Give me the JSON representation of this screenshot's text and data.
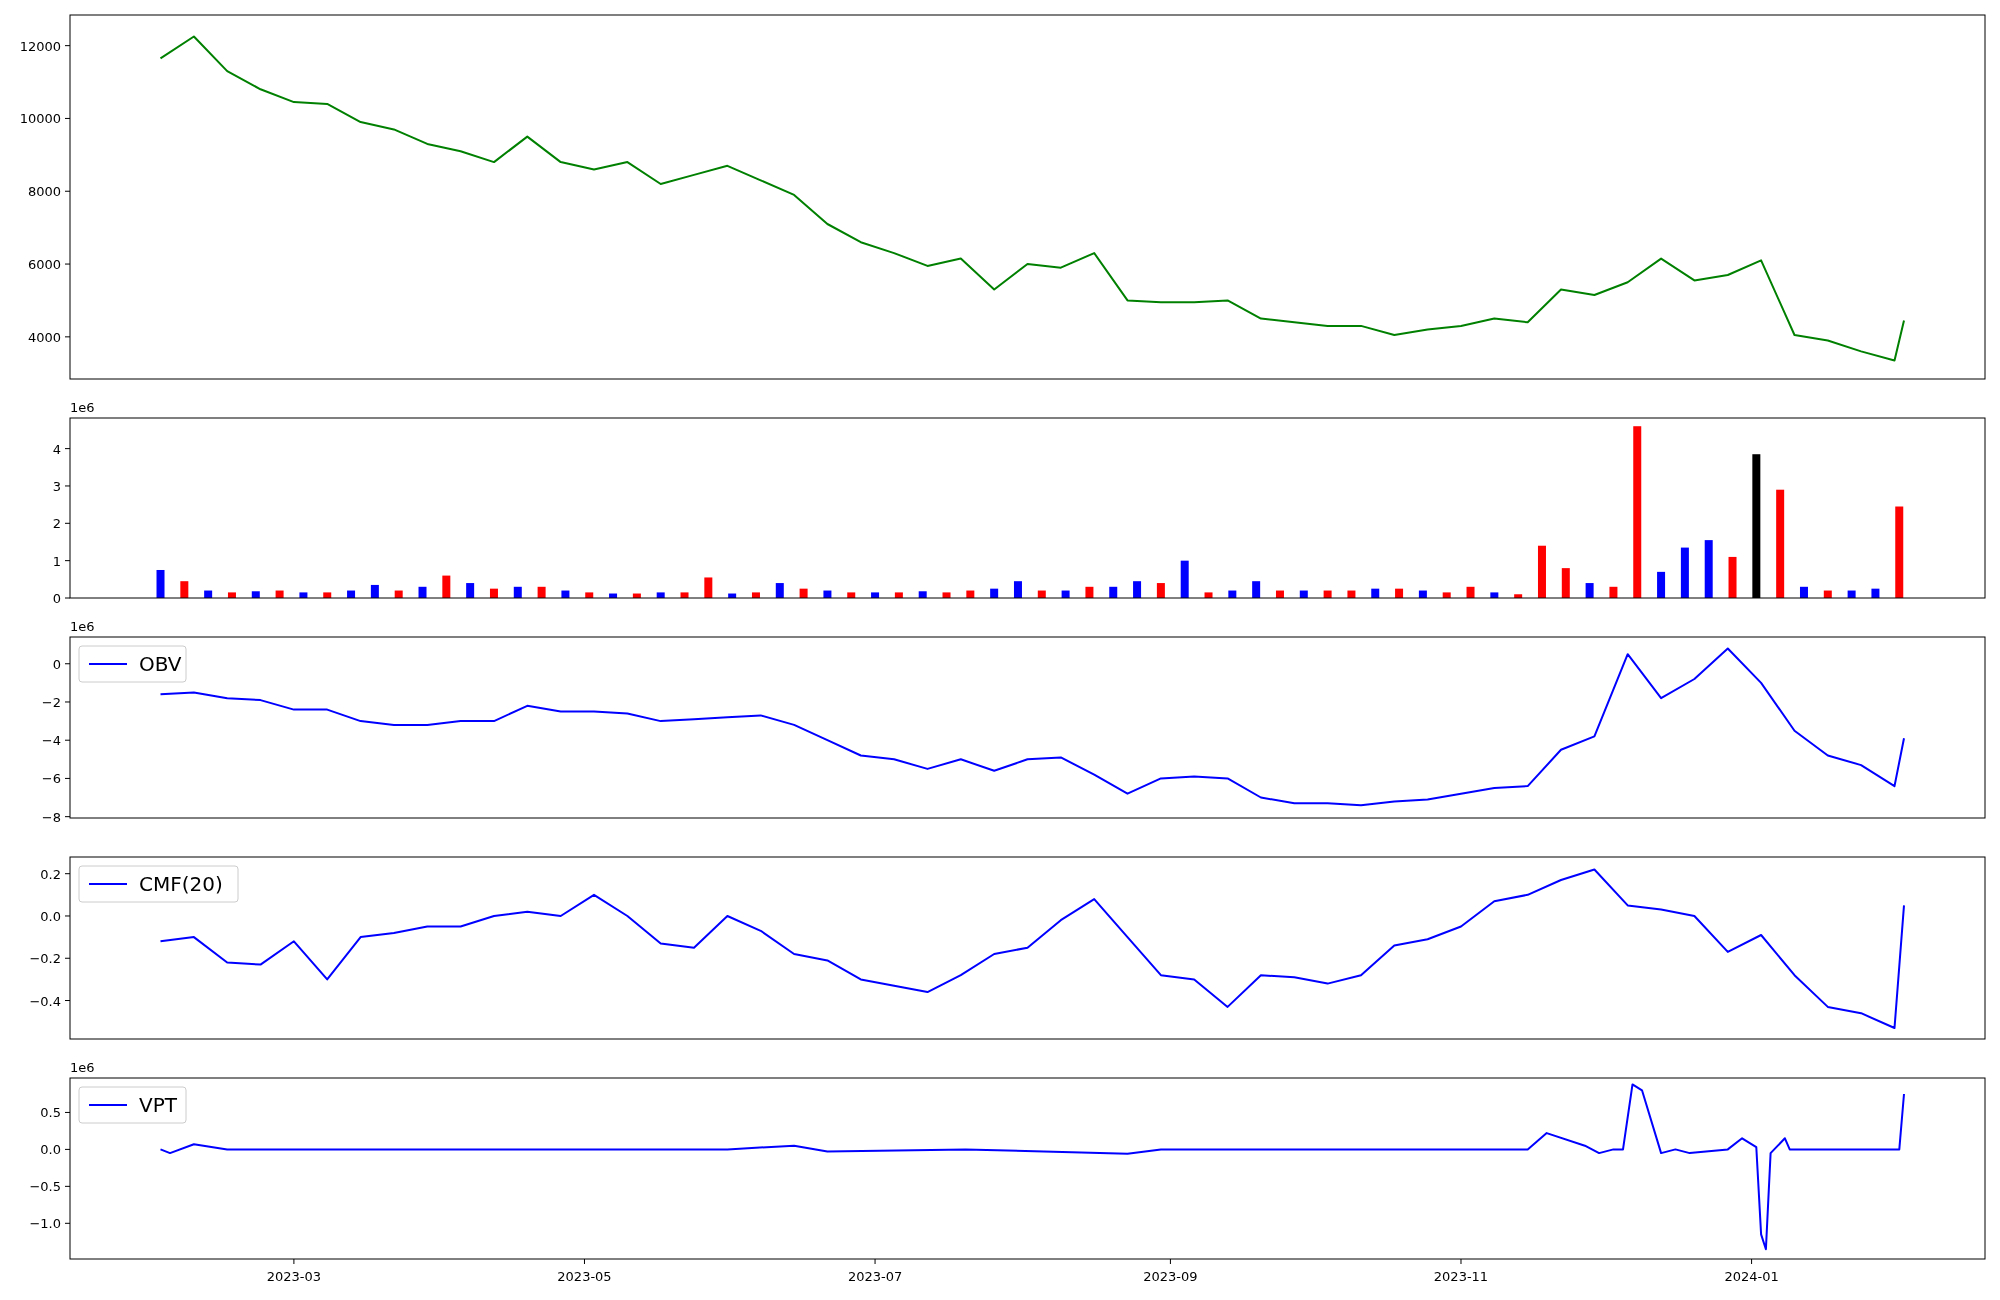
{
  "panels": [
    {
      "chart_data": {
        "type": "line",
        "x": [
          "2023-02-01",
          "2023-02-08",
          "2023-02-15",
          "2023-02-22",
          "2023-03-01",
          "2023-03-08",
          "2023-03-15",
          "2023-03-22",
          "2023-03-29",
          "2023-04-05",
          "2023-04-12",
          "2023-04-19",
          "2023-04-26",
          "2023-05-03",
          "2023-05-10",
          "2023-05-17",
          "2023-05-24",
          "2023-05-31",
          "2023-06-07",
          "2023-06-14",
          "2023-06-21",
          "2023-06-28",
          "2023-07-05",
          "2023-07-12",
          "2023-07-19",
          "2023-07-26",
          "2023-08-02",
          "2023-08-09",
          "2023-08-16",
          "2023-08-23",
          "2023-08-30",
          "2023-09-06",
          "2023-09-13",
          "2023-09-20",
          "2023-09-27",
          "2023-10-04",
          "2023-10-11",
          "2023-10-18",
          "2023-10-25",
          "2023-11-01",
          "2023-11-08",
          "2023-11-15",
          "2023-11-22",
          "2023-11-29",
          "2023-12-06",
          "2023-12-13",
          "2023-12-20",
          "2023-12-27",
          "2024-01-03",
          "2024-01-10",
          "2024-01-17",
          "2024-01-24",
          "2024-01-31",
          "2024-02-02"
        ],
        "series": [
          {
            "color": "#008000",
            "values": [
              11650,
              12250,
              11300,
              10800,
              10450,
              10400,
              9900,
              9700,
              9300,
              9100,
              8800,
              9500,
              8800,
              8600,
              8800,
              8200,
              8450,
              8700,
              8300,
              7900,
              7100,
              6600,
              6300,
              5950,
              6150,
              5300,
              6000,
              5900,
              6300,
              5000,
              4950,
              4950,
              5000,
              4500,
              4400,
              4300,
              4300,
              4050,
              4200,
              4300,
              4500,
              4400,
              5300,
              5150,
              5500,
              6150,
              5550,
              5700,
              6100,
              4050,
              3900,
              3600,
              3350,
              4450
            ]
          }
        ],
        "xlim": [
          "2023-01-13",
          "2024-02-19"
        ],
        "ylim": [
          2842,
          12842
        ],
        "yticks": [
          {
            "value": 4000,
            "label": "4000"
          },
          {
            "value": 6000,
            "label": "6000"
          },
          {
            "value": 8000,
            "label": "8000"
          },
          {
            "value": 10000,
            "label": "10000"
          },
          {
            "value": 12000,
            "label": "12000"
          }
        ]
      }
    },
    {
      "offset_label": "1e6",
      "chart_data": {
        "type": "bar",
        "x": [
          "2023-02-01",
          "2023-02-06",
          "2023-02-11",
          "2023-02-16",
          "2023-02-21",
          "2023-02-26",
          "2023-03-03",
          "2023-03-08",
          "2023-03-13",
          "2023-03-18",
          "2023-03-23",
          "2023-03-28",
          "2023-04-02",
          "2023-04-07",
          "2023-04-12",
          "2023-04-17",
          "2023-04-22",
          "2023-04-27",
          "2023-05-02",
          "2023-05-07",
          "2023-05-12",
          "2023-05-17",
          "2023-05-22",
          "2023-05-27",
          "2023-06-01",
          "2023-06-06",
          "2023-06-11",
          "2023-06-16",
          "2023-06-21",
          "2023-06-26",
          "2023-07-01",
          "2023-07-06",
          "2023-07-11",
          "2023-07-16",
          "2023-07-21",
          "2023-07-26",
          "2023-07-31",
          "2023-08-05",
          "2023-08-10",
          "2023-08-15",
          "2023-08-20",
          "2023-08-25",
          "2023-08-30",
          "2023-09-04",
          "2023-09-09",
          "2023-09-14",
          "2023-09-19",
          "2023-09-24",
          "2023-09-29",
          "2023-10-04",
          "2023-10-09",
          "2023-10-14",
          "2023-10-19",
          "2023-10-24",
          "2023-10-29",
          "2023-11-03",
          "2023-11-08",
          "2023-11-13",
          "2023-11-18",
          "2023-11-23",
          "2023-11-28",
          "2023-12-03",
          "2023-12-08",
          "2023-12-13",
          "2023-12-18",
          "2023-12-23",
          "2023-12-28",
          "2024-01-02",
          "2024-01-07",
          "2024-01-12",
          "2024-01-17",
          "2024-01-22",
          "2024-01-27",
          "2024-02-01"
        ],
        "series": [
          {
            "color": "#0000ff",
            "values": [
              0.75,
              null,
              0.2,
              null,
              0.18,
              null,
              0.15,
              null,
              0.2,
              0.35,
              null,
              0.3,
              null,
              0.4,
              null,
              0.3,
              null,
              0.2,
              null,
              0.12,
              null,
              0.15,
              null,
              null,
              0.12,
              null,
              0.4,
              null,
              0.2,
              null,
              0.15,
              null,
              0.18,
              null,
              null,
              0.25,
              0.45,
              null,
              0.2,
              null,
              0.3,
              0.45,
              null,
              1.0,
              null,
              0.2,
              0.45,
              null,
              0.2,
              null,
              null,
              0.25,
              null,
              0.2,
              null,
              null,
              0.15,
              null,
              null,
              null,
              0.4,
              null,
              null,
              0.7,
              1.35,
              1.55,
              null,
              null,
              null,
              0.3,
              null,
              0.2,
              0.25,
              null
            ]
          },
          {
            "color": "#ff0000",
            "values": [
              null,
              0.45,
              null,
              0.15,
              null,
              0.2,
              null,
              0.15,
              null,
              null,
              0.2,
              null,
              0.6,
              null,
              0.25,
              null,
              0.3,
              null,
              0.15,
              null,
              0.12,
              null,
              0.15,
              0.55,
              null,
              0.15,
              null,
              0.25,
              null,
              0.15,
              null,
              0.15,
              null,
              0.15,
              0.2,
              null,
              null,
              0.2,
              null,
              0.3,
              null,
              null,
              0.4,
              null,
              0.15,
              null,
              null,
              0.2,
              null,
              0.2,
              0.2,
              null,
              0.25,
              null,
              0.15,
              0.3,
              null,
              0.1,
              1.4,
              0.8,
              null,
              0.3,
              4.6,
              null,
              null,
              null,
              1.1,
              null,
              2.9,
              null,
              0.2,
              null,
              null,
              2.45
            ]
          },
          {
            "color": "#000000",
            "values": [
              null,
              null,
              null,
              null,
              null,
              null,
              null,
              null,
              null,
              null,
              null,
              null,
              null,
              null,
              null,
              null,
              null,
              null,
              null,
              null,
              null,
              null,
              null,
              null,
              null,
              null,
              null,
              null,
              null,
              null,
              null,
              null,
              null,
              null,
              null,
              null,
              null,
              null,
              null,
              null,
              null,
              null,
              null,
              null,
              null,
              null,
              null,
              null,
              null,
              null,
              null,
              null,
              null,
              null,
              null,
              null,
              null,
              null,
              null,
              null,
              null,
              null,
              null,
              null,
              null,
              null,
              null,
              3.85,
              null,
              null,
              null,
              null,
              null,
              null
            ]
          }
        ],
        "xlim": [
          "2023-01-13",
          "2024-02-19"
        ],
        "ylim": [
          0,
          4.82
        ],
        "yticks": [
          {
            "value": 0,
            "label": "0"
          },
          {
            "value": 1,
            "label": "1"
          },
          {
            "value": 2,
            "label": "2"
          },
          {
            "value": 3,
            "label": "3"
          },
          {
            "value": 4,
            "label": "4"
          }
        ]
      }
    },
    {
      "offset_label": "1e6",
      "chart_data": {
        "type": "line",
        "x": [
          "2023-02-01",
          "2023-02-08",
          "2023-02-15",
          "2023-02-22",
          "2023-03-01",
          "2023-03-08",
          "2023-03-15",
          "2023-03-22",
          "2023-03-29",
          "2023-04-05",
          "2023-04-12",
          "2023-04-19",
          "2023-04-26",
          "2023-05-03",
          "2023-05-10",
          "2023-05-17",
          "2023-05-24",
          "2023-05-31",
          "2023-06-07",
          "2023-06-14",
          "2023-06-21",
          "2023-06-28",
          "2023-07-05",
          "2023-07-12",
          "2023-07-19",
          "2023-07-26",
          "2023-08-02",
          "2023-08-09",
          "2023-08-16",
          "2023-08-23",
          "2023-08-30",
          "2023-09-06",
          "2023-09-13",
          "2023-09-20",
          "2023-09-27",
          "2023-10-04",
          "2023-10-11",
          "2023-10-18",
          "2023-10-25",
          "2023-11-01",
          "2023-11-08",
          "2023-11-15",
          "2023-11-22",
          "2023-11-29",
          "2023-12-06",
          "2023-12-13",
          "2023-12-20",
          "2023-12-27",
          "2024-01-03",
          "2024-01-10",
          "2024-01-17",
          "2024-01-24",
          "2024-01-31",
          "2024-02-02"
        ],
        "series": [
          {
            "name": "OBV",
            "color": "#0000ff",
            "values": [
              -1.6,
              -1.5,
              -1.8,
              -1.9,
              -2.4,
              -2.4,
              -3.0,
              -3.2,
              -3.2,
              -3.0,
              -3.0,
              -2.2,
              -2.5,
              -2.5,
              -2.6,
              -3.0,
              -2.9,
              -2.8,
              -2.7,
              -3.2,
              -4.0,
              -4.8,
              -5.0,
              -5.5,
              -5.0,
              -5.6,
              -5.0,
              -4.9,
              -5.8,
              -6.8,
              -6.0,
              -5.9,
              -6.0,
              -7.0,
              -7.3,
              -7.3,
              -7.4,
              -7.2,
              -7.1,
              -6.8,
              -6.5,
              -6.4,
              -4.5,
              -3.8,
              0.5,
              -1.8,
              -0.8,
              0.8,
              -1.0,
              -3.5,
              -4.8,
              -5.3,
              -6.4,
              -3.9
            ]
          }
        ],
        "xlim": [
          "2023-01-13",
          "2024-02-19"
        ],
        "ylim": [
          -8.07,
          1.4
        ],
        "yticks": [
          {
            "value": -8,
            "label": "−8"
          },
          {
            "value": -6,
            "label": "−6"
          },
          {
            "value": -4,
            "label": "−4"
          },
          {
            "value": -2,
            "label": "−2"
          },
          {
            "value": 0,
            "label": "0"
          }
        ]
      }
    },
    {
      "chart_data": {
        "type": "line",
        "x": [
          "2023-02-01",
          "2023-02-08",
          "2023-02-15",
          "2023-02-22",
          "2023-03-01",
          "2023-03-08",
          "2023-03-15",
          "2023-03-22",
          "2023-03-29",
          "2023-04-05",
          "2023-04-12",
          "2023-04-19",
          "2023-04-26",
          "2023-05-03",
          "2023-05-10",
          "2023-05-17",
          "2023-05-24",
          "2023-05-31",
          "2023-06-07",
          "2023-06-14",
          "2023-06-21",
          "2023-06-28",
          "2023-07-05",
          "2023-07-12",
          "2023-07-19",
          "2023-07-26",
          "2023-08-02",
          "2023-08-09",
          "2023-08-16",
          "2023-08-23",
          "2023-08-30",
          "2023-09-06",
          "2023-09-13",
          "2023-09-20",
          "2023-09-27",
          "2023-10-04",
          "2023-10-11",
          "2023-10-18",
          "2023-10-25",
          "2023-11-01",
          "2023-11-08",
          "2023-11-15",
          "2023-11-22",
          "2023-11-29",
          "2023-12-06",
          "2023-12-13",
          "2023-12-20",
          "2023-12-27",
          "2024-01-03",
          "2024-01-10",
          "2024-01-17",
          "2024-01-24",
          "2024-01-31",
          "2024-02-02"
        ],
        "series": [
          {
            "name": "CMF(20)",
            "color": "#0000ff",
            "values": [
              -0.12,
              -0.1,
              -0.22,
              -0.23,
              -0.12,
              -0.3,
              -0.1,
              -0.08,
              -0.05,
              -0.05,
              0.0,
              0.02,
              0.0,
              0.1,
              0.0,
              -0.13,
              -0.15,
              0.0,
              -0.07,
              -0.18,
              -0.21,
              -0.3,
              -0.33,
              -0.36,
              -0.28,
              -0.18,
              -0.15,
              -0.02,
              0.08,
              -0.1,
              -0.28,
              -0.3,
              -0.43,
              -0.28,
              -0.29,
              -0.32,
              -0.28,
              -0.14,
              -0.11,
              -0.05,
              0.07,
              0.1,
              0.17,
              0.22,
              0.05,
              0.03,
              0.0,
              -0.17,
              -0.09,
              -0.28,
              -0.43,
              -0.46,
              -0.53,
              0.05
            ]
          }
        ],
        "xlim": [
          "2023-01-13",
          "2024-02-19"
        ],
        "ylim": [
          -0.582,
          0.279
        ],
        "yticks": [
          {
            "value": -0.4,
            "label": "−0.4"
          },
          {
            "value": -0.2,
            "label": "−0.2"
          },
          {
            "value": 0,
            "label": "0.0"
          },
          {
            "value": 0.2,
            "label": "0.2"
          }
        ]
      }
    },
    {
      "offset_label": "1e6",
      "chart_data": {
        "type": "line",
        "x": [
          "2023-02-01",
          "2023-02-03",
          "2023-02-08",
          "2023-02-15",
          "2023-03-01",
          "2023-03-22",
          "2023-04-11",
          "2023-05-31",
          "2023-06-14",
          "2023-06-21",
          "2023-07-20",
          "2023-08-23",
          "2023-08-30",
          "2023-10-28",
          "2023-11-15",
          "2023-11-19",
          "2023-11-27",
          "2023-11-30",
          "2023-12-03",
          "2023-12-05",
          "2023-12-07",
          "2023-12-09",
          "2023-12-13",
          "2023-12-16",
          "2023-12-19",
          "2023-12-27",
          "2023-12-30",
          "2024-01-02",
          "2024-01-03",
          "2024-01-04",
          "2024-01-05",
          "2024-01-08",
          "2024-01-09",
          "2024-02-01",
          "2024-02-02"
        ],
        "series": [
          {
            "name": "VPT",
            "color": "#0000ff",
            "values": [
              0.0,
              -0.05,
              0.07,
              0.0,
              0.0,
              0.0,
              0.0,
              0.0,
              0.05,
              -0.03,
              0.0,
              -0.06,
              0.0,
              0.0,
              0.0,
              0.22,
              0.05,
              -0.05,
              0.0,
              0.0,
              0.88,
              0.8,
              -0.05,
              0.0,
              -0.05,
              0.0,
              0.15,
              0.03,
              -1.15,
              -1.35,
              -0.05,
              0.15,
              0.0,
              0.0,
              0.75
            ]
          }
        ],
        "xlim": [
          "2023-01-13",
          "2024-02-19"
        ],
        "ylim": [
          -1.483,
          0.966
        ],
        "yticks": [
          {
            "value": -1,
            "label": "−1.0"
          },
          {
            "value": -0.5,
            "label": "−0.5"
          },
          {
            "value": 0,
            "label": "0.0"
          },
          {
            "value": 0.5,
            "label": "0.5"
          }
        ],
        "xticks": [
          {
            "value": "2023-03-01",
            "label": "2023-03"
          },
          {
            "value": "2023-05-01",
            "label": "2023-05"
          },
          {
            "value": "2023-07-01",
            "label": "2023-07"
          },
          {
            "value": "2023-09-01",
            "label": "2023-09"
          },
          {
            "value": "2023-11-01",
            "label": "2023-11"
          },
          {
            "value": "2024-01-01",
            "label": "2024-01"
          }
        ]
      }
    }
  ]
}
